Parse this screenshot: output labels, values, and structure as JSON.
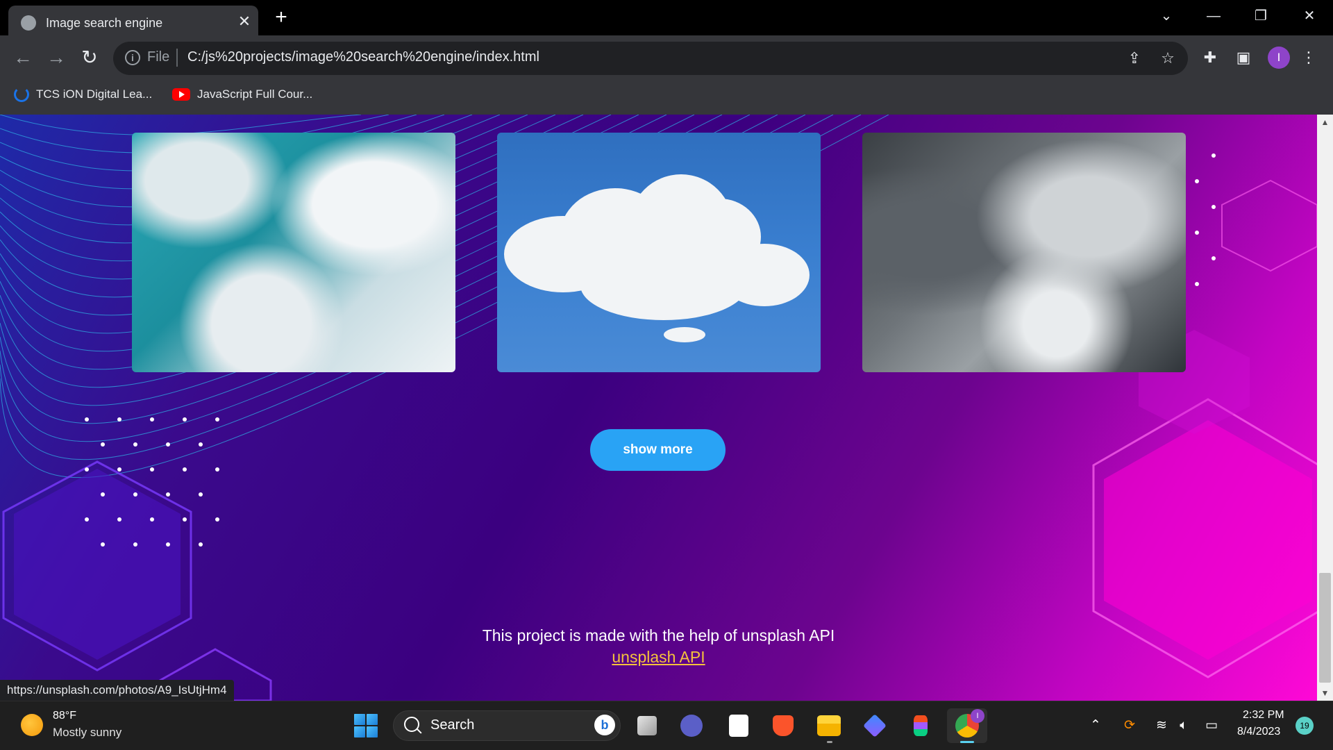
{
  "browser": {
    "tab_title": "Image search engine",
    "tab_close": "✕",
    "new_tab": "+",
    "window_controls": {
      "dropdown": "⌄",
      "minimize": "—",
      "restore": "❐",
      "close": "✕"
    },
    "scheme_label": "File",
    "url": "C:/js%20projects/image%20search%20engine/index.html",
    "profile_initial": "I",
    "bookmarks": [
      {
        "label": "TCS iON Digital Lea...",
        "icon": "tcs-power-icon"
      },
      {
        "label": "JavaScript Full Cour...",
        "icon": "youtube-icon"
      }
    ],
    "status_url": "https://unsplash.com/photos/A9_IsUtjHm4"
  },
  "page": {
    "images": [
      {
        "alt": "teal clouds",
        "icon": "image"
      },
      {
        "alt": "white cloud on blue sky",
        "icon": "image"
      },
      {
        "alt": "dark storm clouds",
        "icon": "image"
      }
    ],
    "show_more_label": "show more",
    "footer_text": "This project is made with the help of unsplash API",
    "footer_link": "unsplash API"
  },
  "taskbar": {
    "weather_temp": "88°F",
    "weather_desc": "Mostly sunny",
    "search_label": "Search",
    "bing_glyph": "b",
    "clock_time": "2:32 PM",
    "clock_date": "8/4/2023",
    "notification_count": "19",
    "chrome_badge": "I"
  },
  "colors": {
    "accent_button": "#29a3f5",
    "link": "#f5c23c",
    "chrome_dark": "#35363a"
  }
}
